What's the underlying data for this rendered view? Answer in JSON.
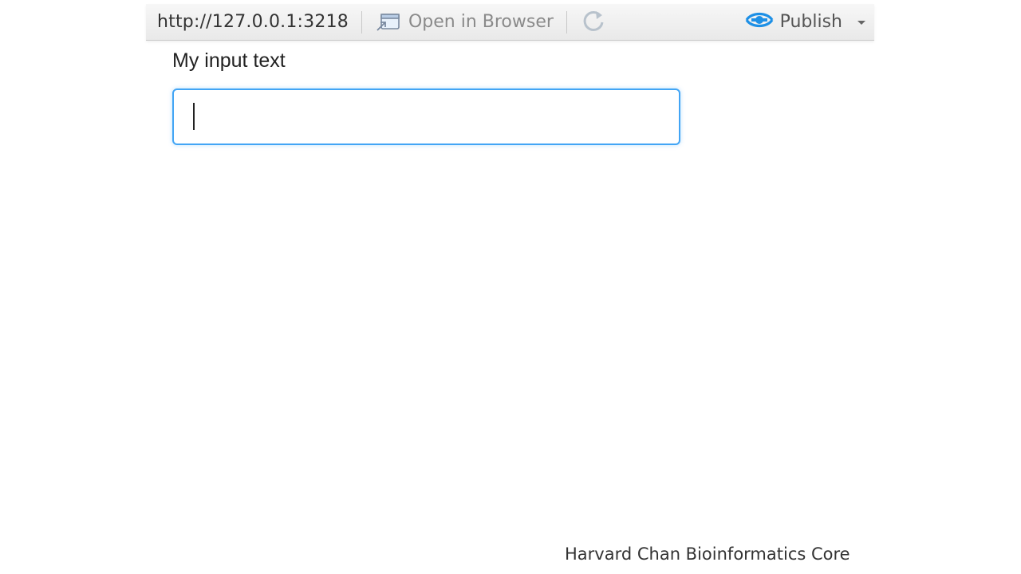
{
  "toolbar": {
    "url": "http://127.0.0.1:3218",
    "open_in_browser_label": "Open in Browser",
    "open_in_browser_icon": "open-in-browser-icon",
    "refresh_icon": "refresh-icon",
    "publish_label": "Publish",
    "publish_icon": "publish-icon",
    "publish_dropdown_icon": "chevron-down-icon"
  },
  "main": {
    "input_label": "My input text",
    "input_value": "",
    "input_placeholder": ""
  },
  "footer": {
    "credit": "Harvard Chan Bioinformatics Core"
  },
  "colors": {
    "focus_border": "#42a5f5",
    "publish_icon": "#1e90e6",
    "toolbar_bg": "#efefef"
  }
}
